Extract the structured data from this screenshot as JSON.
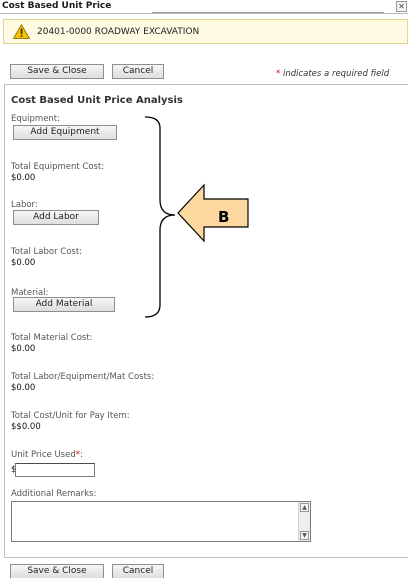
{
  "window": {
    "title": "Cost Based Unit Price",
    "close_icon": "close-icon"
  },
  "alert": {
    "icon": "warning-icon",
    "message": "20401-0000 ROADWAY EXCAVATION"
  },
  "toolbar": {
    "save_close_label": "Save & Close",
    "cancel_label": "Cancel",
    "required_star": "*",
    "required_note": "indicates a required field"
  },
  "form": {
    "heading": "Cost Based Unit Price Analysis",
    "equipment_label": "Equipment:",
    "add_equipment_label": "Add Equipment",
    "total_equipment_label": "Total Equipment Cost:",
    "total_equipment_value": "$0.00",
    "labor_label": "Labor:",
    "add_labor_label": "Add Labor",
    "total_labor_label": "Total Labor Cost:",
    "total_labor_value": "$0.00",
    "material_label": "Material:",
    "add_material_label": "Add Material",
    "total_material_label": "Total Material Cost:",
    "total_material_value": "$0.00",
    "total_lem_label": "Total Labor/Equipment/Mat Costs:",
    "total_lem_value": "$0.00",
    "total_per_unit_label": "Total Cost/Unit for Pay Item:",
    "total_per_unit_value": "$$0.00",
    "unit_price_label": "Unit Price Used",
    "unit_price_required": "*",
    "unit_price_colon": ":",
    "currency_symbol": "$",
    "unit_price_value": "",
    "remarks_label": "Additional Remarks:",
    "remarks_value": ""
  },
  "footer": {
    "save_close_label": "Save & Close",
    "cancel_label": "Cancel"
  },
  "annotation": {
    "letter": "B",
    "arrow_fill": "#fcd7a0"
  }
}
